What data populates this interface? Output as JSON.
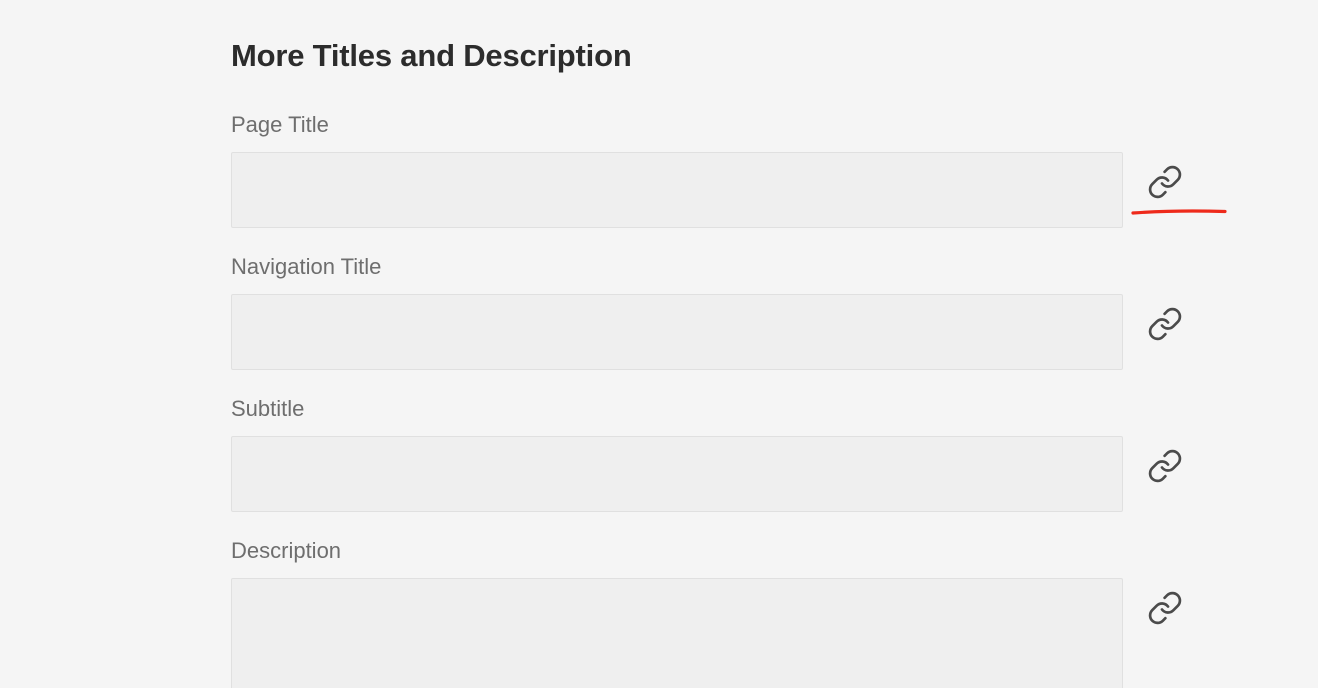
{
  "section": {
    "title": "More Titles and Description"
  },
  "fields": [
    {
      "label": "Page Title",
      "value": "",
      "link_icon": "link-icon"
    },
    {
      "label": "Navigation Title",
      "value": "",
      "link_icon": "link-icon"
    },
    {
      "label": "Subtitle",
      "value": "",
      "link_icon": "link-icon"
    },
    {
      "label": "Description",
      "value": "",
      "link_icon": "link-icon"
    }
  ],
  "annotation": {
    "color": "#ee2a1b"
  },
  "colors": {
    "background": "#f5f5f5",
    "field_background": "#efefef",
    "title_text": "#2c2c2c",
    "label_text": "#6e6e6e",
    "icon": "#4b4b4b"
  }
}
